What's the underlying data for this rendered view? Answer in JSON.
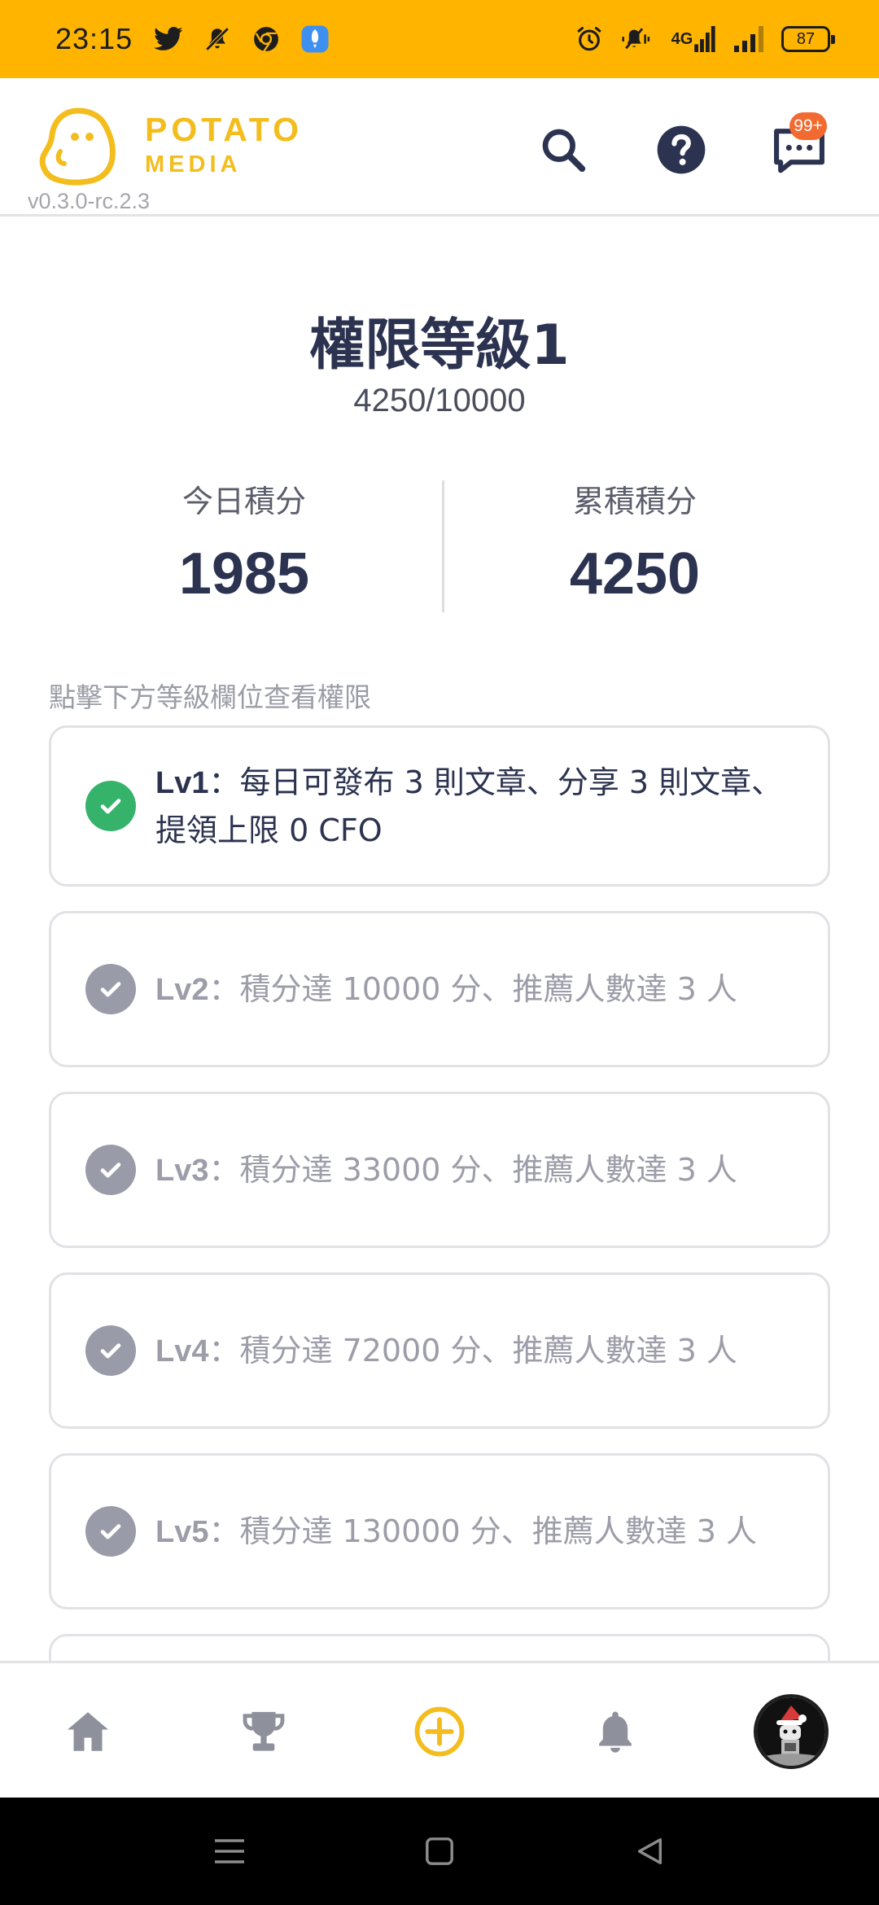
{
  "status_bar": {
    "time": "23:15",
    "left_icons": [
      "twitter-icon",
      "notifications-off-icon",
      "chrome-icon",
      "rocket-app-icon"
    ],
    "network_label": "4G",
    "battery": "87"
  },
  "header": {
    "brand_line1": "POTATO",
    "brand_line2": "MEDIA",
    "version": "v0.3.0-rc.2.3",
    "messages_badge": "99+",
    "brand_color": "#f3bd1d"
  },
  "level": {
    "title": "權限等級1",
    "progress_text": "4250/10000",
    "today_label": "今日積分",
    "today_value": "1985",
    "total_label": "累積積分",
    "total_value": "4250"
  },
  "hint": "點擊下方等級欄位查看權限",
  "levels": [
    {
      "tag": "Lv1",
      "text": "：每日可發布 3 則文章、分享 3 則文章、提領上限 0 CFO",
      "achieved": true
    },
    {
      "tag": "Lv2",
      "text": "：積分達 10000 分、推薦人數達 3 人",
      "achieved": false
    },
    {
      "tag": "Lv3",
      "text": "：積分達 33000 分、推薦人數達 3 人",
      "achieved": false
    },
    {
      "tag": "Lv4",
      "text": "：積分達 72000 分、推薦人數達 3 人",
      "achieved": false
    },
    {
      "tag": "Lv5",
      "text": "：積分達 130000 分、推薦人數達 3 人",
      "achieved": false
    }
  ],
  "tabs": [
    "home-icon",
    "trophy-icon",
    "create-post-icon",
    "bell-icon",
    "profile-avatar"
  ],
  "colors": {
    "status_bar": "#ffb400",
    "achieved_check": "#35b36a",
    "locked_check": "#9a9ba8",
    "create_accent": "#f3bd1d",
    "badge": "#f26a30"
  }
}
